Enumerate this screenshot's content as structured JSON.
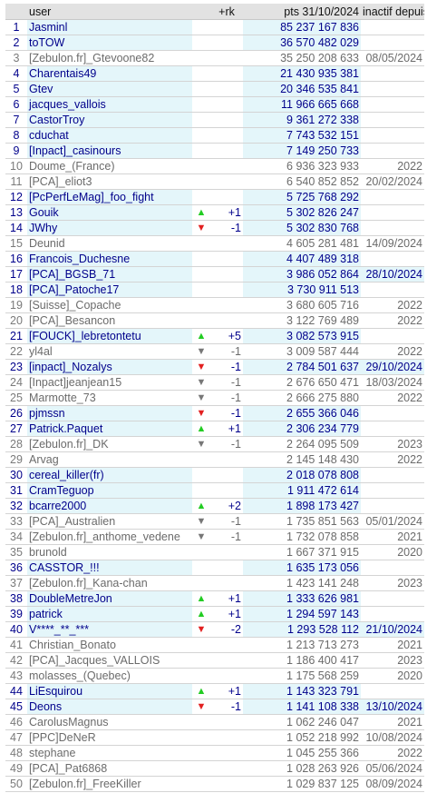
{
  "header": {
    "blank": "",
    "user": "user",
    "rk": "+rk",
    "pts": "pts 31/10/2024",
    "inactive_since": "inactif depuis"
  },
  "colors": {
    "active_text": "#00008b",
    "inactive_text": "#6b6b6b",
    "active_highlight": "#e4f6fa",
    "up_arrow": "#22cc22",
    "down_arrow": "#e22020",
    "neutral_arrow": "#777777"
  },
  "rows": [
    {
      "rank": "1",
      "user": "Jasminl",
      "arrow": "",
      "rk": "",
      "pts": "85 237 167 836",
      "date": "",
      "active": true
    },
    {
      "rank": "2",
      "user": "toTOW",
      "arrow": "",
      "rk": "",
      "pts": "36 570 482 029",
      "date": "",
      "active": true
    },
    {
      "rank": "3",
      "user": "[Zebulon.fr]_Gtevoone82",
      "arrow": "",
      "rk": "",
      "pts": "35 250 208 633",
      "date": "08/05/2024",
      "active": false
    },
    {
      "rank": "4",
      "user": "Charentais49",
      "arrow": "",
      "rk": "",
      "pts": "21 430 935 381",
      "date": "",
      "active": true
    },
    {
      "rank": "5",
      "user": "Gtev",
      "arrow": "",
      "rk": "",
      "pts": "20 346 535 841",
      "date": "",
      "active": true
    },
    {
      "rank": "6",
      "user": "jacques_vallois",
      "arrow": "",
      "rk": "",
      "pts": "11 966 665 668",
      "date": "",
      "active": true
    },
    {
      "rank": "7",
      "user": "CastorTroy",
      "arrow": "",
      "rk": "",
      "pts": "9 361 272 338",
      "date": "",
      "active": true
    },
    {
      "rank": "8",
      "user": "cduchat",
      "arrow": "",
      "rk": "",
      "pts": "7 743 532 151",
      "date": "",
      "active": true
    },
    {
      "rank": "9",
      "user": "[Inpact]_casinours",
      "arrow": "",
      "rk": "",
      "pts": "7 149 250 733",
      "date": "",
      "active": true
    },
    {
      "rank": "10",
      "user": "Doume_(France)",
      "arrow": "",
      "rk": "",
      "pts": "6 936 323 933",
      "date": "2022",
      "active": false
    },
    {
      "rank": "11",
      "user": "[PCA]_eliot3",
      "arrow": "",
      "rk": "",
      "pts": "6 540 852 852",
      "date": "20/02/2024",
      "active": false
    },
    {
      "rank": "12",
      "user": "[PcPerfLeMag]_foo_fight",
      "arrow": "",
      "rk": "",
      "pts": "5 725 768 292",
      "date": "",
      "active": true
    },
    {
      "rank": "13",
      "user": "Gouik",
      "arrow": "up",
      "rk": "+1",
      "pts": "5 302 826 247",
      "date": "",
      "active": true
    },
    {
      "rank": "14",
      "user": "JWhy",
      "arrow": "down",
      "rk": "-1",
      "pts": "5 302 830 768",
      "date": "",
      "active": true
    },
    {
      "rank": "15",
      "user": "Deunid",
      "arrow": "",
      "rk": "",
      "pts": "4 605 281 481",
      "date": "14/09/2024",
      "active": false
    },
    {
      "rank": "16",
      "user": "Francois_Duchesne",
      "arrow": "",
      "rk": "",
      "pts": "4 407 489 318",
      "date": "",
      "active": true
    },
    {
      "rank": "17",
      "user": "[PCA]_BGSB_71",
      "arrow": "",
      "rk": "",
      "pts": "3 986 052 864",
      "date": "28/10/2024",
      "active": true
    },
    {
      "rank": "18",
      "user": "[PCA]_Patoche17",
      "arrow": "",
      "rk": "",
      "pts": "3 730 911 513",
      "date": "",
      "active": true
    },
    {
      "rank": "19",
      "user": "[Suisse]_Copache",
      "arrow": "",
      "rk": "",
      "pts": "3 680 605 716",
      "date": "2022",
      "active": false
    },
    {
      "rank": "20",
      "user": "[PCA]_Besancon",
      "arrow": "",
      "rk": "",
      "pts": "3 122 769 489",
      "date": "2022",
      "active": false
    },
    {
      "rank": "21",
      "user": "[FOUCK]_lebretontetu",
      "arrow": "up",
      "rk": "+5",
      "pts": "3 082 573 915",
      "date": "",
      "active": true
    },
    {
      "rank": "22",
      "user": "yl4al",
      "arrow": "neutral",
      "rk": "-1",
      "pts": "3 009 587 444",
      "date": "2022",
      "active": false
    },
    {
      "rank": "23",
      "user": "[inpact]_Nozalys",
      "arrow": "down",
      "rk": "-1",
      "pts": "2 784 501 637",
      "date": "29/10/2024",
      "active": true
    },
    {
      "rank": "24",
      "user": "[Inpact]jeanjean15",
      "arrow": "neutral",
      "rk": "-1",
      "pts": "2 676 650 471",
      "date": "18/03/2024",
      "active": false
    },
    {
      "rank": "25",
      "user": "Marmotte_73",
      "arrow": "neutral",
      "rk": "-1",
      "pts": "2 666 275 880",
      "date": "2022",
      "active": false
    },
    {
      "rank": "26",
      "user": "pjmssn",
      "arrow": "down",
      "rk": "-1",
      "pts": "2 655 366 046",
      "date": "",
      "active": true
    },
    {
      "rank": "27",
      "user": "Patrick.Paquet",
      "arrow": "up",
      "rk": "+1",
      "pts": "2 306 234 779",
      "date": "",
      "active": true
    },
    {
      "rank": "28",
      "user": "[Zebulon.fr]_DK",
      "arrow": "neutral",
      "rk": "-1",
      "pts": "2 264 095 509",
      "date": "2023",
      "active": false
    },
    {
      "rank": "29",
      "user": "Arvag",
      "arrow": "",
      "rk": "",
      "pts": "2 145 148 430",
      "date": "2022",
      "active": false
    },
    {
      "rank": "30",
      "user": "cereal_killer(fr)",
      "arrow": "",
      "rk": "",
      "pts": "2 018 078 808",
      "date": "",
      "active": true
    },
    {
      "rank": "31",
      "user": "CramTeguop",
      "arrow": "",
      "rk": "",
      "pts": "1 911 472 614",
      "date": "",
      "active": true
    },
    {
      "rank": "32",
      "user": "bcarre2000",
      "arrow": "up",
      "rk": "+2",
      "pts": "1 898 173 427",
      "date": "",
      "active": true
    },
    {
      "rank": "33",
      "user": "[PCA]_Australien",
      "arrow": "neutral",
      "rk": "-1",
      "pts": "1 735 851 563",
      "date": "05/01/2024",
      "active": false
    },
    {
      "rank": "34",
      "user": "[Zebulon.fr]_anthome_vedene",
      "arrow": "neutral",
      "rk": "-1",
      "pts": "1 732 078 858",
      "date": "2021",
      "active": false
    },
    {
      "rank": "35",
      "user": "brunold",
      "arrow": "",
      "rk": "",
      "pts": "1 667 371 915",
      "date": "2020",
      "active": false
    },
    {
      "rank": "36",
      "user": "CASSTOR_!!!",
      "arrow": "",
      "rk": "",
      "pts": "1 635 173 056",
      "date": "",
      "active": true
    },
    {
      "rank": "37",
      "user": "[Zebulon.fr]_Kana-chan",
      "arrow": "",
      "rk": "",
      "pts": "1 423 141 248",
      "date": "2023",
      "active": false
    },
    {
      "rank": "38",
      "user": "DoubleMetreJon",
      "arrow": "up",
      "rk": "+1",
      "pts": "1 333 626 981",
      "date": "",
      "active": true
    },
    {
      "rank": "39",
      "user": "patrick",
      "arrow": "up",
      "rk": "+1",
      "pts": "1 294 597 143",
      "date": "",
      "active": true
    },
    {
      "rank": "40",
      "user": "V****_**_***",
      "arrow": "down",
      "rk": "-2",
      "pts": "1 293 528 112",
      "date": "21/10/2024",
      "active": true
    },
    {
      "rank": "41",
      "user": "Christian_Bonato",
      "arrow": "",
      "rk": "",
      "pts": "1 213 713 273",
      "date": "2021",
      "active": false
    },
    {
      "rank": "42",
      "user": "[PCA]_Jacques_VALLOIS",
      "arrow": "",
      "rk": "",
      "pts": "1 186 400 417",
      "date": "2023",
      "active": false
    },
    {
      "rank": "43",
      "user": "molasses_(Quebec)",
      "arrow": "",
      "rk": "",
      "pts": "1 175 568 259",
      "date": "2020",
      "active": false
    },
    {
      "rank": "44",
      "user": "LiEsquirou",
      "arrow": "up",
      "rk": "+1",
      "pts": "1 143 323 791",
      "date": "",
      "active": true
    },
    {
      "rank": "45",
      "user": "Deons",
      "arrow": "down",
      "rk": "-1",
      "pts": "1 141 108 338",
      "date": "13/10/2024",
      "active": true
    },
    {
      "rank": "46",
      "user": "CarolusMagnus",
      "arrow": "",
      "rk": "",
      "pts": "1 062 246 047",
      "date": "2021",
      "active": false
    },
    {
      "rank": "47",
      "user": "[PPC]DeNeR",
      "arrow": "",
      "rk": "",
      "pts": "1 052 218 992",
      "date": "10/08/2024",
      "active": false
    },
    {
      "rank": "48",
      "user": "stephane",
      "arrow": "",
      "rk": "",
      "pts": "1 045 255 366",
      "date": "2022",
      "active": false
    },
    {
      "rank": "49",
      "user": "[PCA]_Pat6868",
      "arrow": "",
      "rk": "",
      "pts": "1 028 263 926",
      "date": "05/06/2024",
      "active": false
    },
    {
      "rank": "50",
      "user": "[Zebulon.fr]_FreeKiller",
      "arrow": "",
      "rk": "",
      "pts": "1 029 837 125",
      "date": "08/09/2024",
      "active": false
    }
  ]
}
